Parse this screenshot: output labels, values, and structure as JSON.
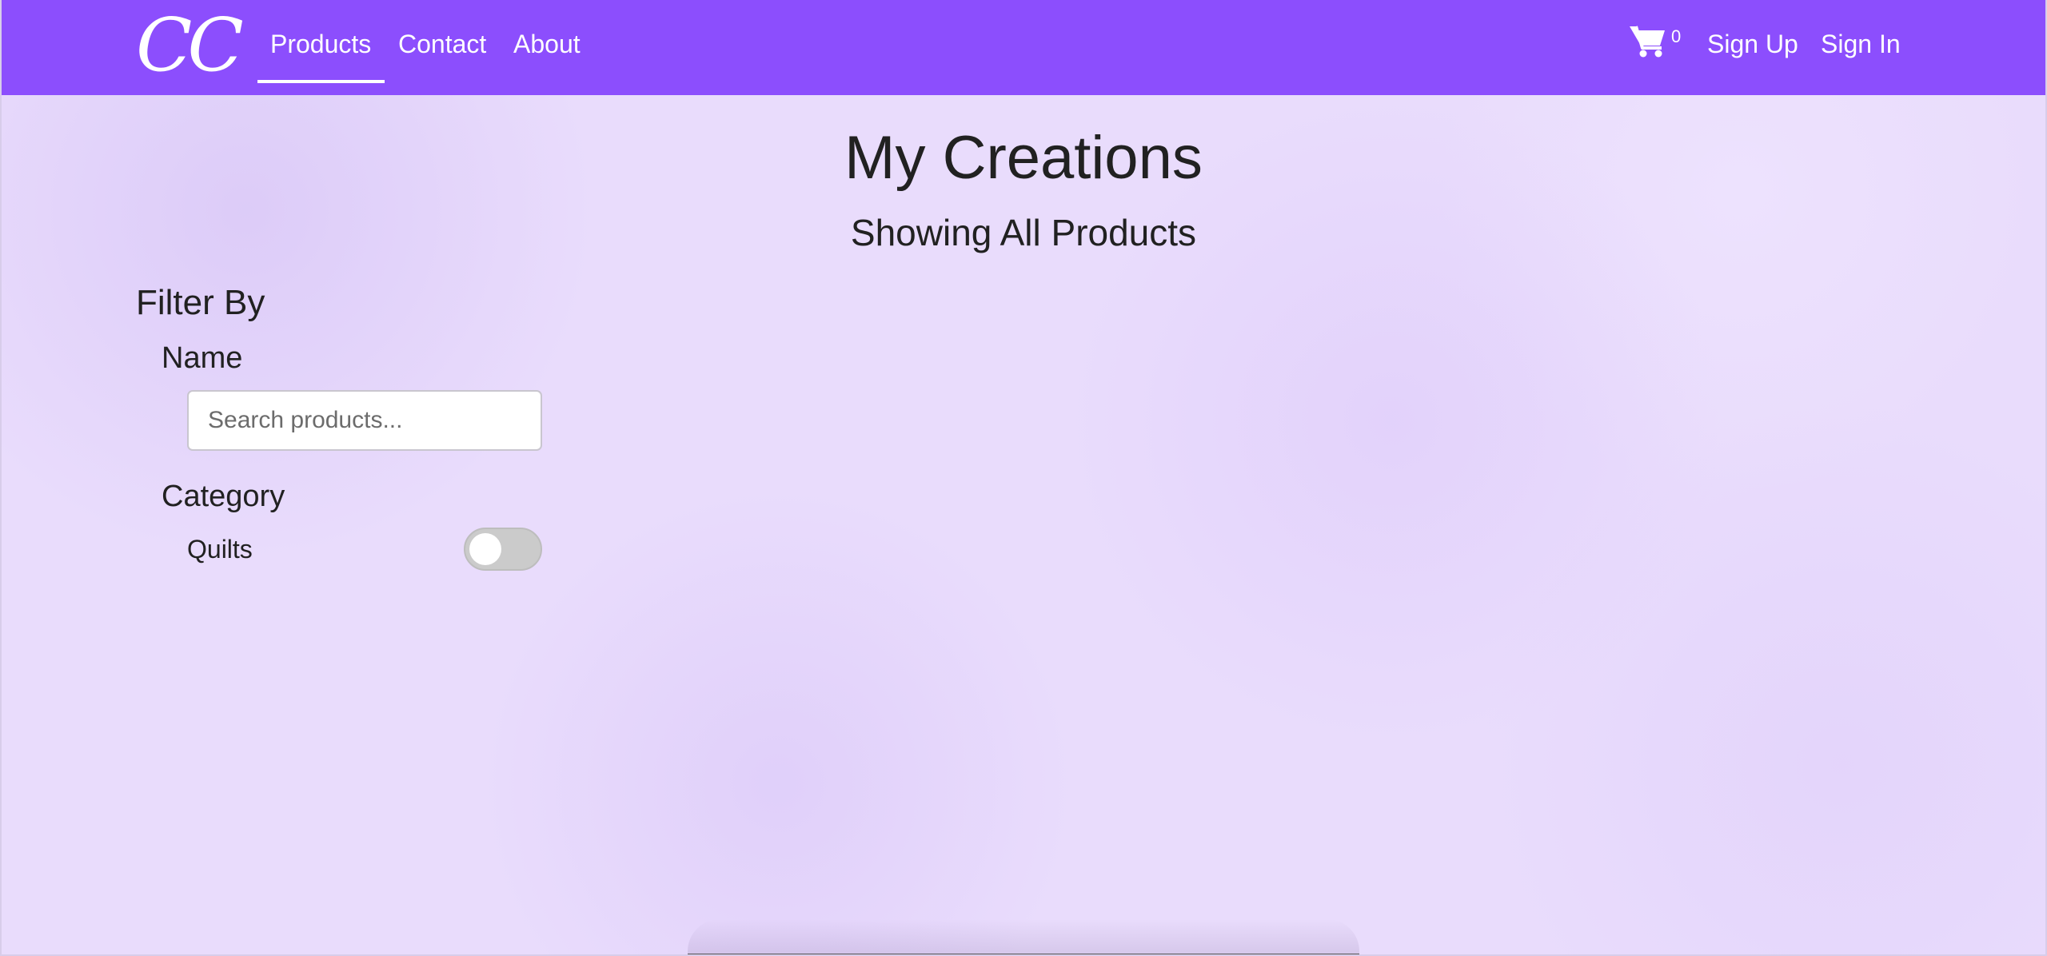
{
  "navbar": {
    "brand": "CC",
    "links": [
      {
        "label": "Products",
        "active": true
      },
      {
        "label": "Contact"
      },
      {
        "label": "About"
      }
    ],
    "cart": {
      "icon": "cart-icon",
      "count": "0"
    },
    "sign_up": "Sign Up",
    "sign_in": "Sign In",
    "background_color": "#8c4efd"
  },
  "main": {
    "title": "My Creations",
    "subtitle": "Showing All Products"
  },
  "filters": {
    "heading": "Filter By",
    "name": {
      "label": "Name",
      "value": "",
      "placeholder": "Search products..."
    },
    "category": {
      "label": "Category",
      "options": [
        {
          "label": "Quilts",
          "checked": false
        }
      ]
    }
  },
  "colors": {
    "page_background": "#e9dcfc",
    "text": "#212121"
  }
}
